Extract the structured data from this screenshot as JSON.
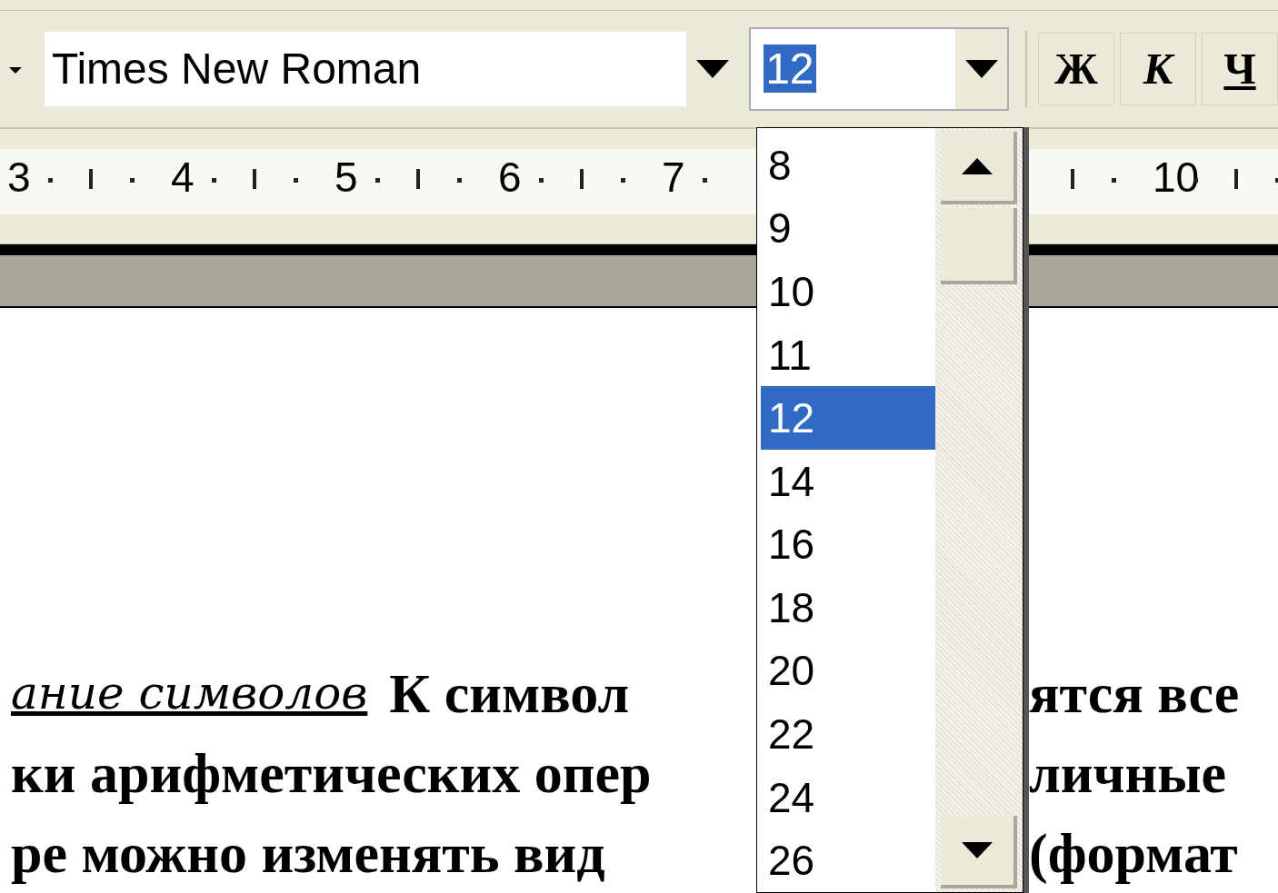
{
  "toolbar": {
    "font_name": {
      "value": "Times New Roman"
    },
    "font_size": {
      "value": "12"
    },
    "format_buttons": [
      {
        "kind": "bold",
        "label": "Ж"
      },
      {
        "kind": "italic",
        "label": "К"
      },
      {
        "kind": "underline",
        "label": "Ч"
      }
    ]
  },
  "ruler": {
    "labels": [
      "3",
      "4",
      "5",
      "6",
      "7",
      "10"
    ]
  },
  "size_dropdown": {
    "items": [
      {
        "label": "8",
        "selected": false
      },
      {
        "label": "9",
        "selected": false
      },
      {
        "label": "10",
        "selected": false
      },
      {
        "label": "11",
        "selected": false
      },
      {
        "label": "12",
        "selected": true
      },
      {
        "label": "14",
        "selected": false
      },
      {
        "label": "16",
        "selected": false
      },
      {
        "label": "18",
        "selected": false
      },
      {
        "label": "20",
        "selected": false
      },
      {
        "label": "22",
        "selected": false
      },
      {
        "label": "24",
        "selected": false
      },
      {
        "label": "26",
        "selected": false
      }
    ]
  },
  "document": {
    "lines": [
      {
        "left": [
          {
            "kind": "script",
            "text": "ание символов"
          },
          {
            "kind": "plain",
            "text": "К символ"
          }
        ],
        "right": "ятся все"
      },
      {
        "left": [
          {
            "kind": "plain",
            "text": "ки арифметических опер"
          }
        ],
        "right": "личные"
      },
      {
        "left": [
          {
            "kind": "plain",
            "text": "ре можно изменять вид"
          }
        ],
        "right": "(формат"
      }
    ]
  }
}
